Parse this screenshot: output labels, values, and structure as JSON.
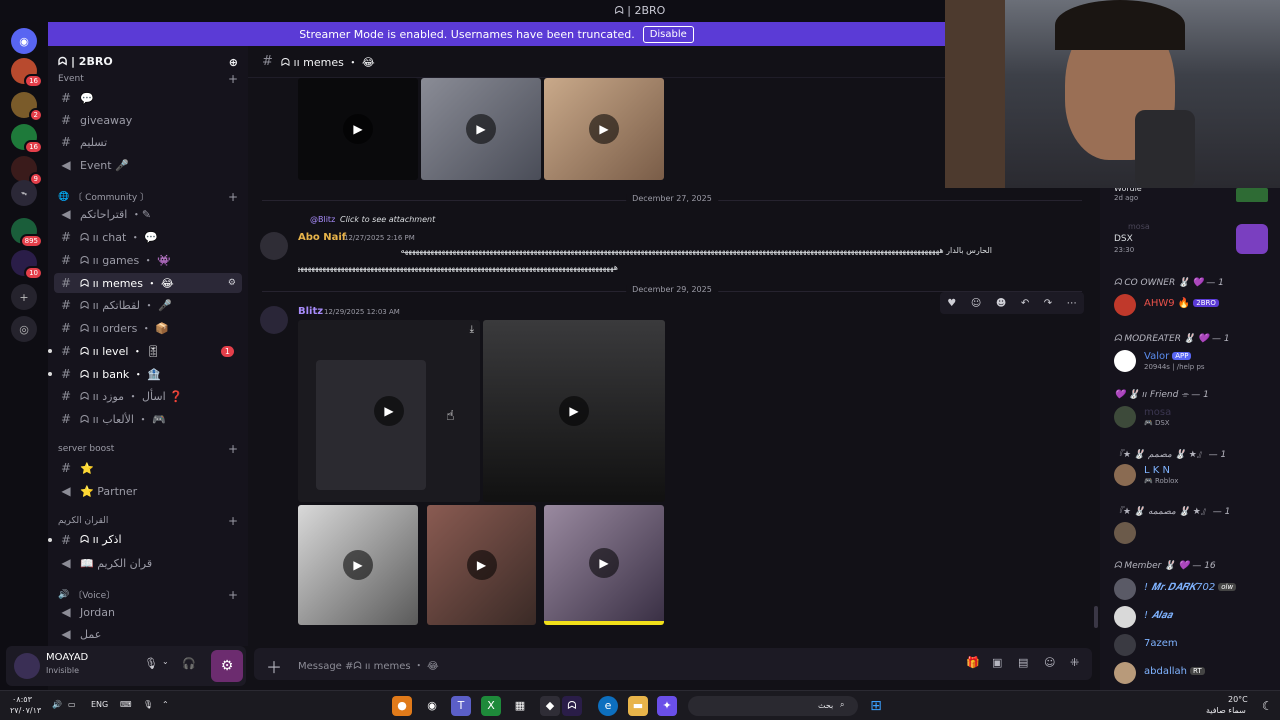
{
  "titlebar": {
    "title": "ᗣ | 2BRO"
  },
  "streamer": {
    "message": "Streamer Mode is enabled. Usernames have been truncated.",
    "disable_label": "Disable"
  },
  "guild_rail": {
    "badges": [
      "16",
      "2",
      "16",
      "9",
      "895",
      "10"
    ]
  },
  "server": {
    "name": "ᗣ | 2BRO"
  },
  "categories": [
    {
      "label": "Event"
    },
    {
      "label": "〔 Community 〕"
    },
    {
      "label": "server boost"
    },
    {
      "label": "القران الكريم"
    },
    {
      "label": "〔Voice〕"
    }
  ],
  "channels": [
    {
      "label": "💬"
    },
    {
      "label": "giveaway"
    },
    {
      "label": "تسليم"
    },
    {
      "label": "Event 🎤"
    },
    {
      "label": "اقتراحاتكم ・✎"
    },
    {
      "label": "ᗣ ıı chat ・ 💬"
    },
    {
      "label": "ᗣ ıı games ・ 👾"
    },
    {
      "label": "ᗣ ıı memes ・ 😂"
    },
    {
      "label": "ᗣ ıı لقطاتكم ・ 🎤"
    },
    {
      "label": "ᗣ ıı orders ・ 📦"
    },
    {
      "label": "ᗣ ıı level ・ 🎚",
      "unread": "1"
    },
    {
      "label": "ᗣ ıı bank ・ 🏦"
    },
    {
      "label": "ᗣ ıı اسأل ・ موزد ❓"
    },
    {
      "label": "ᗣ ıı الألعاب ・ 🎮"
    },
    {
      "label": "⭐"
    },
    {
      "label": "⭐ Partner"
    },
    {
      "label": "ᗣ ıı اذكر"
    },
    {
      "label": "📖 قران الكريم"
    },
    {
      "label": "Jordan"
    },
    {
      "label": "عمل"
    }
  ],
  "user": {
    "name": "MOAYAD",
    "status": "Invisible"
  },
  "chat": {
    "channel_title": "ᗣ ıı memes ・ 😂",
    "composer_placeholder": "Message #ᗣ ıı memes ・ 😂",
    "date1": "December 27, 2025",
    "date2": "December 29, 2025",
    "reply_author": "@Blitz",
    "reply_text": "Click to see attachment",
    "msg1_author": "Abo Naif",
    "msg1_time": "12/27/2025 2:16 PM",
    "msg1_line1": "الحارس بالدار ههههههههههههههههههههههههههههههههههههههههههههههههههههههههههههههههههههههههههههههههههههههههههههههههههههههههههههههههههههههههههههههههههههههههههههههههههه",
    "msg1_line2": "هههههههههههههههههههههههههههههههههههههههههههههههههههههههههههههههههههههههههههههههههههههههههههههههههههههههههههههههههههه",
    "msg2_author": "Blitz",
    "msg2_time": "12/29/2025 12:03 AM"
  },
  "members": {
    "roles": [
      "ᗣ CO OWNER 🐰 💜 — 1",
      "ᗣ MODREATER 🐰 💜 — 1",
      "💜 🐰 ıı Friend ⌯ — 1",
      "『★ 🐰 مصمم 🐰 ★』 — 1",
      "『★ 🐰 مصممه 🐰 ★』 — 1",
      "ᗣ Member 🐰 💜 — 16"
    ],
    "top": [
      {
        "name": "Wordle",
        "sub": "2d ago"
      },
      {
        "name": "mosa",
        "sub": ""
      },
      {
        "name": "DSX",
        "sub": "23:30"
      }
    ],
    "list": [
      {
        "name": "AHW9 🔥",
        "badge": "2BRO",
        "sub": "",
        "color": "#e8514a"
      },
      {
        "name": "Valor",
        "badge": "APP",
        "sub": "20944s | /help ps",
        "color": "#5b8def"
      },
      {
        "name": "mosa",
        "badge": "",
        "sub": "🎮 DSX",
        "color": "#3b3650"
      },
      {
        "name": "L K N",
        "badge": "",
        "sub": "🎮 Roblox",
        "color": "#7fb3ff"
      },
      {
        "name": "",
        "badge": "",
        "sub": "",
        "color": "#ffffff"
      },
      {
        "name": "! 𝑴𝒓.𝑫𝑨𝑹𝑲702",
        "badge": "olw",
        "sub": "",
        "color": "#7fb3ff"
      },
      {
        "name": "! 𝑨𝒍𝒂𝒂",
        "badge": "",
        "sub": "",
        "color": "#7fb3ff"
      },
      {
        "name": "7azem",
        "badge": "",
        "sub": "",
        "color": "#7fb3ff"
      },
      {
        "name": "abdallah",
        "badge": "RT",
        "sub": "",
        "color": "#7fb3ff"
      }
    ]
  },
  "taskbar": {
    "time": "٠٨:٥٣",
    "date": "٢٧/٠٧/١٣",
    "lang": "ENG",
    "search": "بحث",
    "weather_temp": "20°C",
    "weather_desc": "سماء صافية"
  },
  "colors": {
    "accent": "#5b3bd6",
    "unread": "#e43f4a",
    "author1": "#e8b44a",
    "author2": "#a78bfa"
  }
}
